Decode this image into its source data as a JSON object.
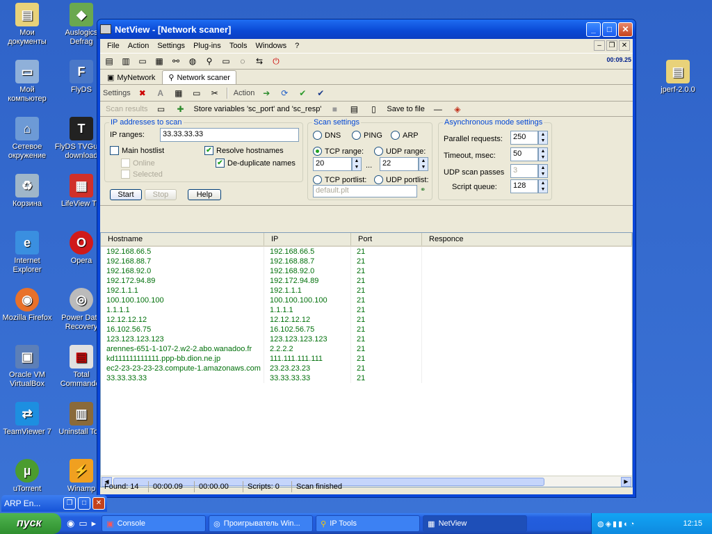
{
  "desktop_icons": [
    {
      "label": "Мои документы"
    },
    {
      "label": "Auslogics Defrag"
    },
    {
      "label": "Мой компьютер"
    },
    {
      "label": "FlyDS"
    },
    {
      "label": "Сетевое окружение"
    },
    {
      "label": "FlyDS TVGuide download"
    },
    {
      "label": "Корзина"
    },
    {
      "label": "LifeView TV"
    },
    {
      "label": "Internet Explorer"
    },
    {
      "label": "Opera"
    },
    {
      "label": "Mozilla Firefox"
    },
    {
      "label": "Power Data Recovery"
    },
    {
      "label": "Oracle VM VirtualBox"
    },
    {
      "label": "Total Commander"
    },
    {
      "label": "TeamViewer 7"
    },
    {
      "label": "Uninstall Tool"
    },
    {
      "label": "uTorrent"
    },
    {
      "label": "Winamp"
    },
    {
      "label": "jperf-2.0.0"
    }
  ],
  "window": {
    "title": "NetView - [Network scaner]",
    "menu": [
      "File",
      "Action",
      "Settings",
      "Plug-ins",
      "Tools",
      "Windows",
      "?"
    ],
    "timer": "00:09.25",
    "tabs": [
      "MyNetwork",
      "Network scaner"
    ],
    "bar2": {
      "settings_label": "Settings",
      "action_label": "Action"
    },
    "bar3": {
      "scan_results": "Scan results",
      "store_vars": "Store variables 'sc_port' and 'sc_resp'",
      "save_to_file": "Save to file"
    }
  },
  "ip_group": {
    "title": "IP addresses to scan",
    "ranges_label": "IP ranges:",
    "ranges_value": "33.33.33.33",
    "main_hostlist": "Main hostlist",
    "online": "Online",
    "selected": "Selected",
    "resolve": "Resolve hostnames",
    "dedup": "De-duplicate names"
  },
  "buttons": {
    "start": "Start",
    "stop": "Stop",
    "help": "Help"
  },
  "scan_group": {
    "title": "Scan settings",
    "dns": "DNS",
    "ping": "PING",
    "arp": "ARP",
    "tcp_range": "TCP range:",
    "udp_range": "UDP range:",
    "tcp_from": "20",
    "range_dots": "...",
    "tcp_to": "22",
    "tcp_portlist": "TCP portlist:",
    "udp_portlist": "UDP portlist:",
    "portlist_file": "default.plt"
  },
  "async_group": {
    "title": "Asynchronous mode settings",
    "parallel_label": "Parallel requests:",
    "parallel_value": "250",
    "timeout_label": "Timeout, msec:",
    "timeout_value": "50",
    "udp_passes_label": "UDP scan passes",
    "udp_passes_value": "3",
    "script_queue_label": "Script queue:",
    "script_queue_value": "128"
  },
  "table": {
    "columns": [
      "Hostname",
      "IP",
      "Port",
      "Responce"
    ],
    "rows": [
      [
        "192.168.66.5",
        "192.168.66.5",
        "21"
      ],
      [
        "192.168.88.7",
        "192.168.88.7",
        "21"
      ],
      [
        "192.168.92.0",
        "192.168.92.0",
        "21"
      ],
      [
        "192.172.94.89",
        "192.172.94.89",
        "21"
      ],
      [
        "192.1.1.1",
        "192.1.1.1",
        "21"
      ],
      [
        "100.100.100.100",
        "100.100.100.100",
        "21"
      ],
      [
        "1.1.1.1",
        "1.1.1.1",
        "21"
      ],
      [
        "12.12.12.12",
        "12.12.12.12",
        "21"
      ],
      [
        "16.102.56.75",
        "16.102.56.75",
        "21"
      ],
      [
        "123.123.123.123",
        "123.123.123.123",
        "21"
      ],
      [
        "arennes-651-1-107-2.w2-2.abo.wanadoo.fr",
        "2.2.2.2",
        "21"
      ],
      [
        "kd111111111111.ppp-bb.dion.ne.jp",
        "111.111.111.111",
        "21"
      ],
      [
        "ec2-23-23-23-23.compute-1.amazonaws.com",
        "23.23.23.23",
        "21"
      ],
      [
        "33.33.33.33",
        "33.33.33.33",
        "21"
      ]
    ]
  },
  "status": {
    "found": "Found: 14",
    "elapsed": "00:00.09",
    "remaining": "00:00.00",
    "scripts": "Scripts: 0",
    "state": "Scan finished"
  },
  "mini_window": {
    "title": "ARP En..."
  },
  "taskbar": {
    "start": "пуск",
    "tasks": [
      "Console",
      "Проигрыватель Win...",
      "IP Tools",
      "NetView"
    ],
    "clock": "12:15"
  }
}
